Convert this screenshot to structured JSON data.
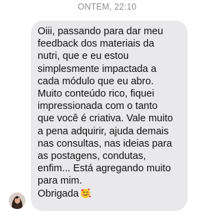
{
  "chat": {
    "timestamp": "ONTEM, 22:10",
    "message": {
      "text": "Oiii, passando para dar meu\nfeedback dos materiais da\nnutri, que e eu estou\nsimplesmente impactada a\ncada módulo que eu abro.\nMuito conteúdo rico, fiquei\nimpressionada com o tanto\nque você é criativa. Vale muito\na pena adquirir, ajuda demais\nnas consultas, nas ideias para\nas postagens, condutas,\nenfim... Está agregando muito\npara mim.\nObrigada",
      "emoji": "smiling-face-with-hearts",
      "bubble_color": "#e9e9eb",
      "text_color": "#111111"
    },
    "timestamp_color": "#8e8e93"
  }
}
